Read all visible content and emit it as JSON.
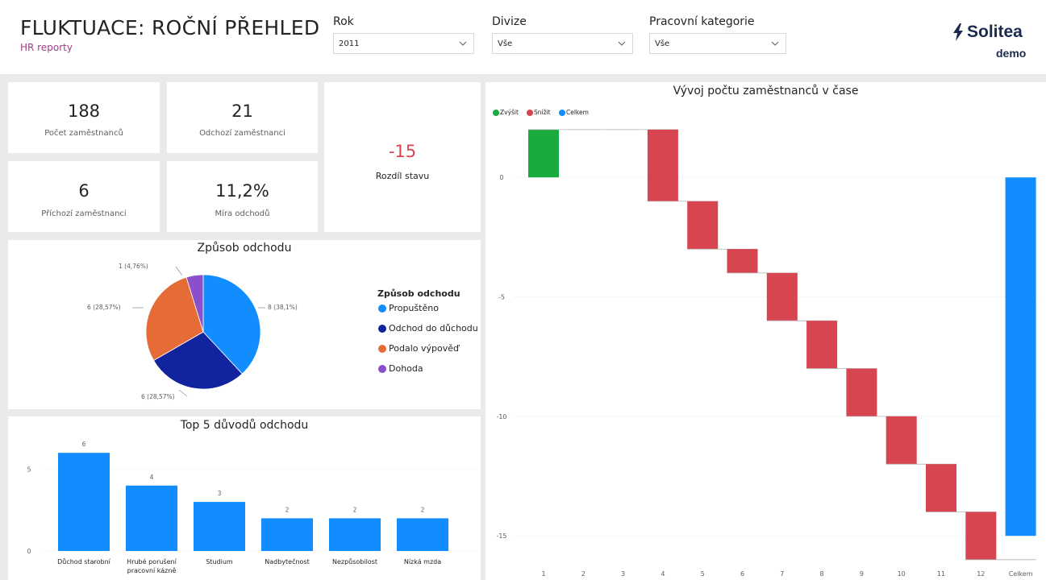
{
  "header": {
    "title": "FLUKTUACE: ROČNÍ PŘEHLED",
    "subtitle": "HR reporty",
    "logo_text": "Solitea",
    "logo_sub": "demo"
  },
  "filters": [
    {
      "label": "Rok",
      "value": "2011"
    },
    {
      "label": "Divize",
      "value": "Vše"
    },
    {
      "label": "Pracovní kategorie",
      "value": "Vše"
    }
  ],
  "kpis": {
    "employees": {
      "value": "188",
      "label": "Počet zaměstnanců"
    },
    "leaving": {
      "value": "21",
      "label": "Odchozí zaměstnanci"
    },
    "incoming": {
      "value": "6",
      "label": "Příchozí zaměstnanci"
    },
    "turnover_rate": {
      "value": "11,2%",
      "label": "Míra odchodů"
    },
    "difference": {
      "value": "-15",
      "label": "Rozdíl stavu"
    }
  },
  "colors": {
    "increase": "#1aab40",
    "decrease": "#d64550",
    "total": "#118dff",
    "accent": "#a33c88",
    "negative_kpi": "#d64550",
    "pie": [
      "#118dff",
      "#12239e",
      "#e66c37",
      "#6b007b"
    ]
  },
  "chart_data": [
    {
      "type": "pie",
      "title": "Způsob odchodu",
      "legend_title": "Způsob odchodu",
      "categories": [
        "Propuštěno",
        "Odchod do důchodu",
        "Podalo výpověď",
        "Dohoda"
      ],
      "values": [
        8,
        6,
        6,
        1
      ],
      "data_labels": [
        "8 (38,1%)",
        "6 (28,57%)",
        "6 (28,57%)",
        "1 (4,76%)"
      ],
      "colors": [
        "#118dff",
        "#12239e",
        "#e66c37",
        "#8a4fc9"
      ],
      "legend_position": "right"
    },
    {
      "type": "bar",
      "title": "Top 5 důvodů odchodu",
      "categories": [
        "Důchod starobní",
        "Hrubé porušení pracovní kázně",
        "Studium",
        "Nadbytečnost",
        "Nezpůsobilost",
        "Nízká mzda"
      ],
      "category_lines": [
        [
          "Důchod starobní"
        ],
        [
          "Hrubé porušení",
          "pracovní kázně"
        ],
        [
          "Studium"
        ],
        [
          "Nadbytečnost"
        ],
        [
          "Nezpůsobilost"
        ],
        [
          "Nízká mzda"
        ]
      ],
      "values": [
        6,
        4,
        3,
        2,
        2,
        2
      ],
      "ylim": [
        0,
        6.5
      ],
      "yticks": [
        0,
        5
      ],
      "grid": true,
      "color": "#118dff"
    },
    {
      "type": "waterfall",
      "title": "Vývoj počtu zaměstnanců v čase",
      "legend": [
        "Zvýšit",
        "Snížit",
        "Celkem"
      ],
      "legend_position": "top-left",
      "categories": [
        "1",
        "2",
        "3",
        "4",
        "5",
        "6",
        "7",
        "8",
        "9",
        "10",
        "11",
        "12",
        "Celkem"
      ],
      "changes": [
        2,
        0,
        0,
        -3,
        -2,
        -1,
        -2,
        -2,
        -2,
        -2,
        -2,
        -2
      ],
      "total": -15,
      "ylim": [
        -15.5,
        2.3
      ],
      "yticks": [
        0,
        -5,
        -10,
        -15
      ],
      "grid": true
    }
  ]
}
